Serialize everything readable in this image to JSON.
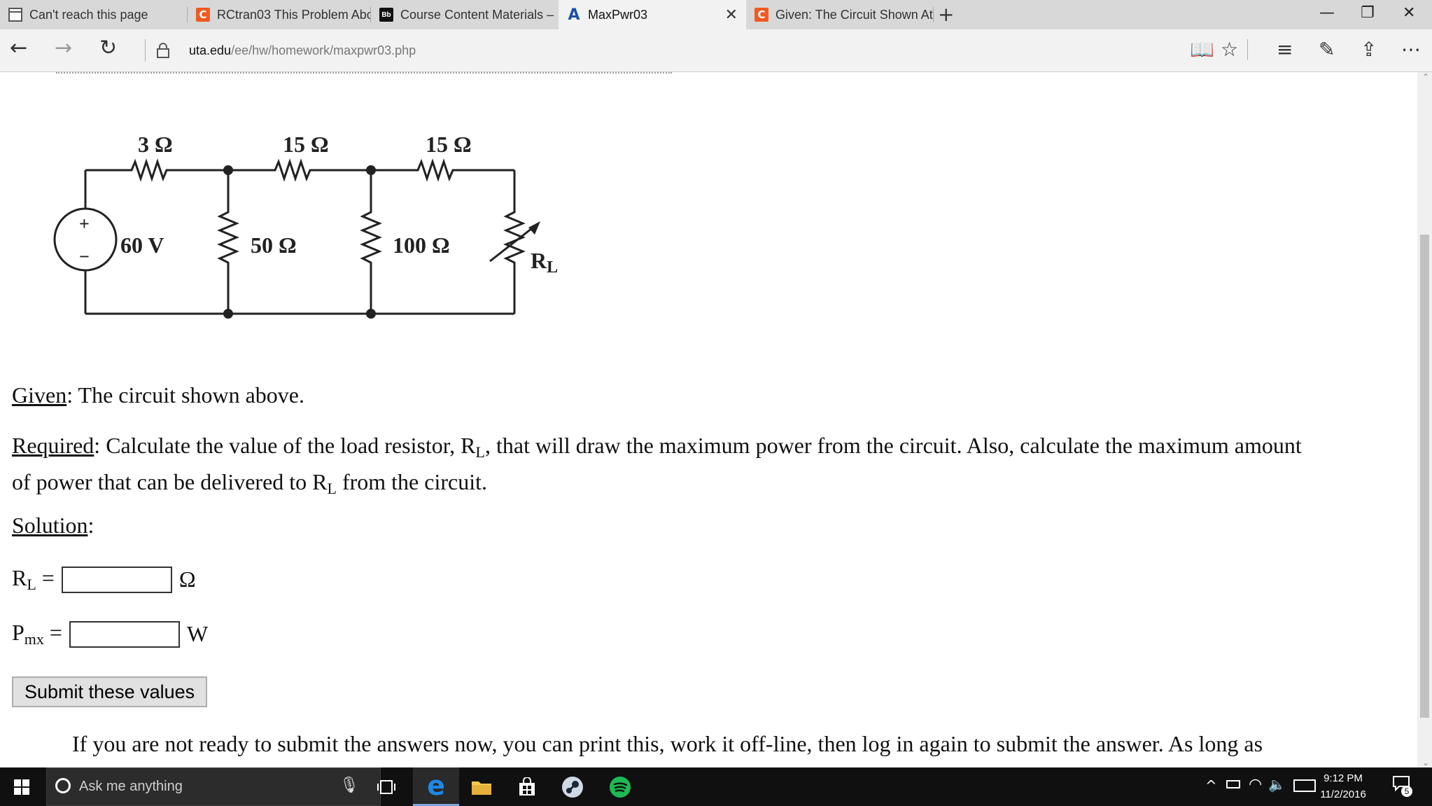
{
  "browser": {
    "tabs": [
      {
        "title": "Can't reach this page",
        "favicon": "page-icon",
        "active": false
      },
      {
        "title": "RCtran03 This Problem Abo",
        "favicon": "chegg-c-icon",
        "active": false
      },
      {
        "title": "Course Content Materials –",
        "favicon": "blackboard-icon",
        "active": false
      },
      {
        "title": "MaxPwr03",
        "favicon": "uta-a-icon",
        "active": true
      },
      {
        "title": "Given: The Circuit Shown At",
        "favicon": "chegg-c-icon",
        "active": false
      }
    ],
    "url_host": "uta.edu",
    "url_path": "/ee/hw/homework/maxpwr03.php",
    "icons": {
      "fav_c": "C",
      "fav_bb": "Bb",
      "fav_a": "A"
    }
  },
  "circuit": {
    "r1": "3 Ω",
    "r2": "15 Ω",
    "r3": "15 Ω",
    "source": "60 V",
    "r4": "50 Ω",
    "r5": "100 Ω",
    "load_main": "R",
    "load_sub": "L",
    "plus": "+",
    "minus": "−"
  },
  "problem": {
    "given_label": "Given",
    "given_text": ": The circuit shown above.",
    "required_label": "Required",
    "required_line1_a": ": Calculate the value of the load resistor, R",
    "required_line1_sub": "L",
    "required_line1_b": ", that will draw the maximum power from the circuit. Also, calculate the maximum amount",
    "required_line2_a": "of power that can be delivered to R",
    "required_line2_sub": "L",
    "required_line2_b": " from the circuit.",
    "solution_label": "Solution",
    "solution_colon": ":"
  },
  "form": {
    "rl_main": "R",
    "rl_sub": "L",
    "equals": " =",
    "rl_value": "",
    "rl_unit": "Ω",
    "pmx_main": "P",
    "pmx_sub": "mx",
    "pmx_value": "",
    "pmx_unit": "W",
    "submit_label": "Submit these values"
  },
  "footer_text": "If you are not ready to submit the answers now, you can print this, work it off-line, then log in again to submit the answer. As long as",
  "taskbar": {
    "search_placeholder": "Ask me anything",
    "time": "9:12 PM",
    "date": "11/2/2016",
    "notification_count": "5"
  },
  "colors": {
    "taskbar_bg": "#101010",
    "edge_blue": "#1e88e5",
    "spotify_green": "#1db954",
    "chegg_orange": "#f05a22",
    "uta_blue": "#1b4ea8"
  }
}
